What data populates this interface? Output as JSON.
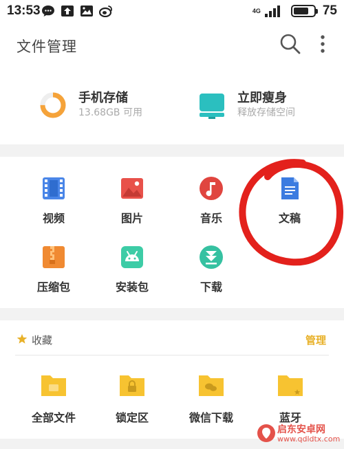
{
  "status_bar": {
    "time": "13:53",
    "network": "4G",
    "battery_percent": "75",
    "battery_level": 0.75,
    "icons": [
      "chat-icon",
      "upload-icon",
      "image-icon",
      "weibo-icon",
      "signal-icon",
      "battery-icon"
    ]
  },
  "header": {
    "title": "文件管理",
    "icons": [
      "search-icon",
      "more-vertical-icon"
    ]
  },
  "storage": {
    "phone": {
      "title": "手机存储",
      "subtitle": "13.68GB 可用",
      "usage_ratio": 0.75,
      "icon": "storage-ring-icon"
    },
    "clean": {
      "title": "立即瘦身",
      "subtitle": "释放存储空间",
      "icon": "clean-icon"
    }
  },
  "categories": [
    {
      "label": "视频",
      "icon": "video-icon",
      "color": "#4a86e8"
    },
    {
      "label": "图片",
      "icon": "picture-icon",
      "color": "#e8514a"
    },
    {
      "label": "音乐",
      "icon": "music-icon",
      "color": "#e0453f"
    },
    {
      "label": "文稿",
      "icon": "document-icon",
      "color": "#3b7be0"
    },
    {
      "label": "压缩包",
      "icon": "archive-icon",
      "color": "#f08a32"
    },
    {
      "label": "安装包",
      "icon": "android-icon",
      "color": "#3dcca6"
    },
    {
      "label": "下载",
      "icon": "download-icon",
      "color": "#36c1a1"
    }
  ],
  "favorites": {
    "title": "收藏",
    "manage_label": "管理",
    "items": [
      {
        "label": "全部文件",
        "icon": "folder-image-icon"
      },
      {
        "label": "锁定区",
        "icon": "folder-lock-icon"
      },
      {
        "label": "微信下载",
        "icon": "folder-wechat-icon"
      },
      {
        "label": "蓝牙",
        "icon": "folder-star-icon"
      }
    ]
  },
  "watermark": {
    "text": "启东安卓网",
    "url": "www.qdldtx.com"
  },
  "colors": {
    "accent": "#e8b129",
    "storage_orange": "#f5a33a",
    "clean_teal": "#2bbfbf",
    "annotation_red": "#e3211c"
  }
}
